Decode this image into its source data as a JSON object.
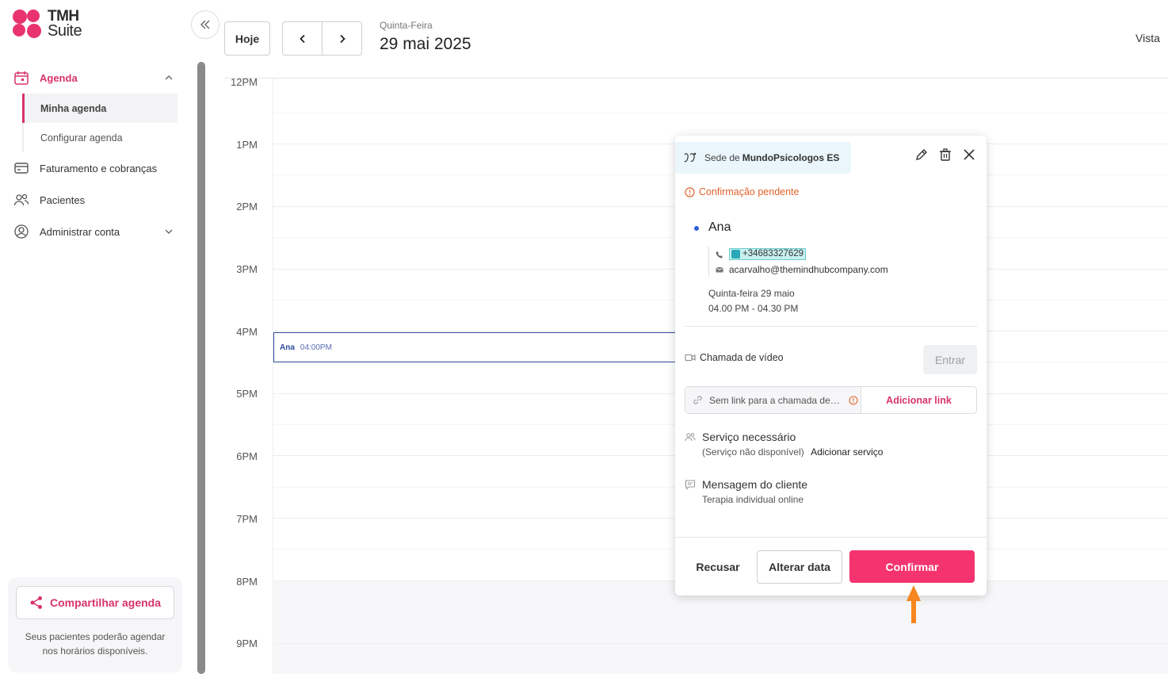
{
  "brand": {
    "line1": "TMH",
    "line2": "Suite",
    "color": "#e8336f"
  },
  "sidebar": {
    "items": [
      {
        "label": "Agenda",
        "icon": "calendar-icon",
        "active": true
      },
      {
        "label": "Faturamento e cobranças",
        "icon": "credit-card-icon"
      },
      {
        "label": "Pacientes",
        "icon": "users-icon"
      },
      {
        "label": "Administrar conta",
        "icon": "user-circle-icon"
      }
    ],
    "agenda_sub": [
      "Minha agenda",
      "Configurar agenda"
    ],
    "share_button": "Compartilhar agenda",
    "share_note": "Seus pacientes poderão agendar nos horários disponíveis."
  },
  "topbar": {
    "today": "Hoje",
    "weekday": "Quinta-Feira",
    "date": "29 mai 2025",
    "view": "Vista"
  },
  "calendar": {
    "hours": [
      "12PM",
      "1PM",
      "2PM",
      "3PM",
      "4PM",
      "5PM",
      "6PM",
      "7PM",
      "8PM",
      "9PM"
    ],
    "event": {
      "name": "Ana",
      "time": "04:00PM"
    }
  },
  "popup": {
    "sede_prefix": "Sede de",
    "sede_name": "MundoPsicologos ES",
    "status": "Confirmação pendente",
    "client_name": "Ana",
    "phone": "+34683327629",
    "email": "acarvalho@themindhubcompany.com",
    "appt_day": "Quinta-feira 29 maio",
    "appt_time": "04.00 PM - 04.30 PM",
    "video_label": "Chamada de vídeo",
    "enter": "Entrar",
    "no_link": "Sem link para a chamada de vídeo",
    "add_link": "Adicionar link",
    "service_title": "Serviço necessário",
    "service_none": "(Serviço não disponível)",
    "add_service": "Adicionar serviço",
    "message_title": "Mensagem do cliente",
    "message_text": "Terapia individual online",
    "refuse": "Recusar",
    "change_date": "Alterar data",
    "confirm": "Confirmar"
  },
  "colors": {
    "accent": "#f4336f",
    "pending": "#e0632a",
    "event": "#2e4b9b",
    "pointer": "#f7861f"
  }
}
